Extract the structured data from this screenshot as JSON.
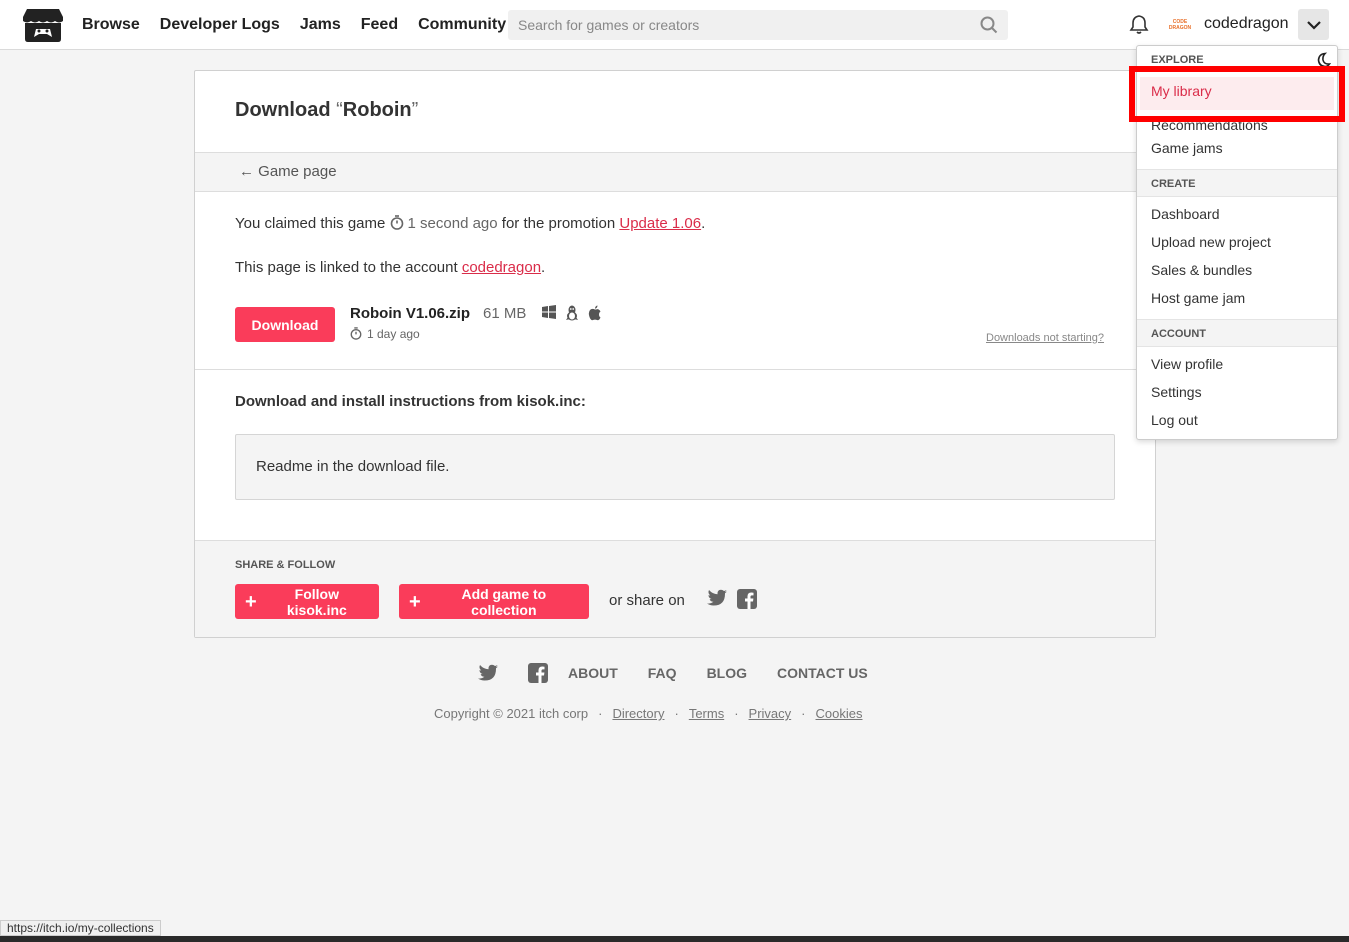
{
  "header": {
    "nav": [
      "Browse",
      "Developer Logs",
      "Jams",
      "Feed",
      "Community"
    ],
    "search_placeholder": "Search for games or creators",
    "avatar_text": "CODE DRAGON",
    "username": "codedragon"
  },
  "page": {
    "title_prefix": "Download ",
    "title_open_quote": "“",
    "title_game": "Roboin",
    "title_close_quote": "”",
    "back_link": "← Game page",
    "claim_prefix": "You claimed this game ",
    "claim_time": "1 second ago",
    "claim_mid": " for the promotion ",
    "claim_promotion": "Update 1.06",
    "claim_suffix": ".",
    "linked_prefix": "This page is linked to the account ",
    "linked_account": "codedragon",
    "linked_suffix": ".",
    "download_button": "Download",
    "file_name": "Roboin V1.06.zip",
    "file_size": "61 MB",
    "file_date": "1 day ago",
    "platform_icons": [
      "windows-icon",
      "linux-icon",
      "apple-icon"
    ],
    "downloads_help": "Downloads not starting?",
    "instructions_title": "Download and install instructions from kisok.inc:",
    "readme_text": "Readme in the download file.",
    "share_label": "SHARE & FOLLOW",
    "follow_button": "Follow kisok.inc",
    "collection_button": "Add game to collection",
    "share_on": "or share on"
  },
  "footer": {
    "links": [
      "ABOUT",
      "FAQ",
      "BLOG",
      "CONTACT US"
    ],
    "copyright": "Copyright © 2021 itch corp",
    "legal_links": [
      "Directory",
      "Terms",
      "Privacy",
      "Cookies"
    ]
  },
  "dropdown": {
    "explore_label": "EXPLORE",
    "explore_items": [
      "My library",
      "Recommendations",
      "Game jams"
    ],
    "create_label": "CREATE",
    "create_items": [
      "Dashboard",
      "Upload new project",
      "Sales & bundles",
      "Host game jam"
    ],
    "account_label": "ACCOUNT",
    "account_items": [
      "View profile",
      "Settings",
      "Log out"
    ]
  },
  "status_bar": {
    "url": "https://itch.io/my-collections"
  },
  "colors": {
    "accent": "#fa3c5a",
    "link": "#da2c49",
    "highlight_border": "#ff0000"
  }
}
